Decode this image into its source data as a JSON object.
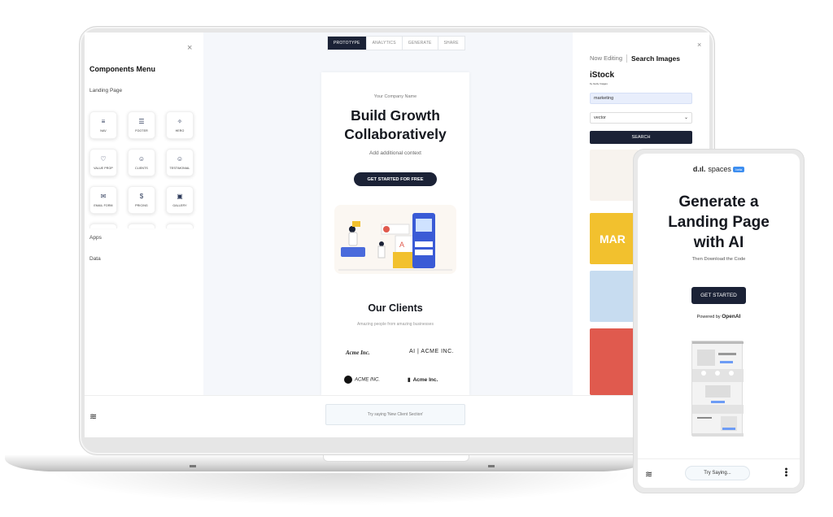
{
  "app": {
    "tabs": [
      {
        "label": "PROTOTYPE",
        "active": true
      },
      {
        "label": "ANALYTICS",
        "active": false
      },
      {
        "label": "GENERATE",
        "active": false
      },
      {
        "label": "SHARE",
        "active": false
      }
    ]
  },
  "components_menu": {
    "title": "Components Menu",
    "close": "×",
    "sections": [
      "Landing Page",
      "Apps",
      "Data"
    ],
    "tiles": [
      {
        "label": "NAV",
        "icon": "≡",
        "icon_name": "nav-icon"
      },
      {
        "label": "FOOTER",
        "icon": "☰",
        "icon_name": "footer-icon"
      },
      {
        "label": "HERO",
        "icon": "✧",
        "icon_name": "hero-icon"
      },
      {
        "label": "VALUE PROP",
        "icon": "♡",
        "icon_name": "diamond-icon"
      },
      {
        "label": "CLIENTS",
        "icon": "☺",
        "icon_name": "user-icon"
      },
      {
        "label": "TESTIMONIAL",
        "icon": "☺",
        "icon_name": "chat-smile-icon"
      },
      {
        "label": "EMAIL FORM",
        "icon": "✉",
        "icon_name": "mail-icon"
      },
      {
        "label": "PRICING",
        "icon": "$",
        "icon_name": "dollar-icon"
      },
      {
        "label": "GALLERY",
        "icon": "▣",
        "icon_name": "gallery-icon"
      }
    ]
  },
  "preview": {
    "company_name": "Your Company Name",
    "hero_title_line1": "Build Growth",
    "hero_title_line2": "Collaboratively",
    "hero_subtitle": "Add additional context",
    "cta_label": "GET STARTED FOR FREE",
    "clients_title": "Our Clients",
    "clients_subtitle": "Amazing people from amazing businesses",
    "client_logos": [
      "Acme Inc.",
      "AI | ACME INC.",
      "ACME INC.",
      "Acme Inc."
    ]
  },
  "search_panel": {
    "now_editing": "Now Editing",
    "title": "Search Images",
    "provider": "iStock",
    "provider_sub": "by Getty Images",
    "query": "marketing",
    "type_option": "vector",
    "search_label": "SEARCH",
    "close": "×",
    "thumb_colors": [
      "#f7f3ee",
      "#f2c12e",
      "#c7dcf0",
      "#e05a4e"
    ]
  },
  "bottom_bar": {
    "prompt_placeholder": "Try saying 'New Client Section'"
  },
  "phone": {
    "brand": "spaces",
    "badge": "beta",
    "title_line1": "Generate a",
    "title_line2": "Landing Page",
    "title_line3": "with AI",
    "subtitle": "Then Download the Code",
    "cta_label": "GET STARTED",
    "powered_prefix": "Powered by ",
    "powered_brand": "OpenAI",
    "try_label": "Try Saying..."
  }
}
